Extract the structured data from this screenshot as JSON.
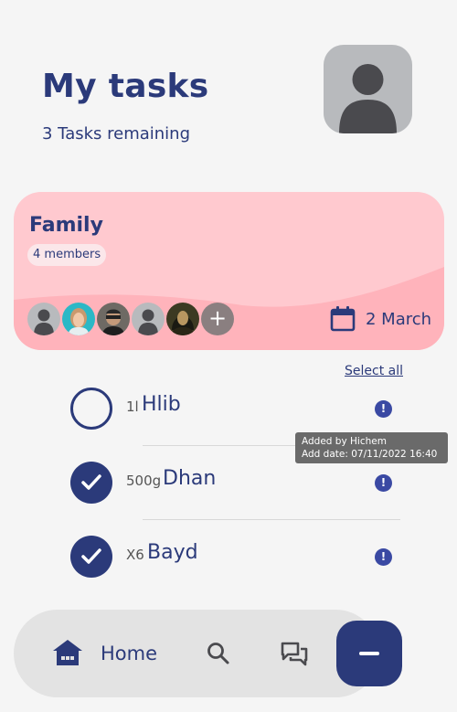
{
  "header": {
    "title": "My tasks",
    "subtitle": "3 Tasks remaining"
  },
  "profile": {
    "icon": "person-icon"
  },
  "family": {
    "title": "Family",
    "members_label": "4 members",
    "date": "2 March",
    "add_icon": "+",
    "card_color": "#ffc9cf"
  },
  "list": {
    "select_all": "Select all",
    "tasks": [
      {
        "qty": "1l",
        "name": "Hlib",
        "done": false
      },
      {
        "qty": "500g",
        "name": "Dhan",
        "done": true
      },
      {
        "qty": "X6",
        "name": "Bayd",
        "done": true
      }
    ],
    "tooltip": {
      "line1": "Added by Hichem",
      "line2": "Add date: 07/11/2022 16:40"
    }
  },
  "nav": {
    "home_label": "Home",
    "icons": [
      "home-icon",
      "search-icon",
      "chat-icon",
      "minus-icon"
    ]
  },
  "colors": {
    "primary": "#2b3a7a",
    "background": "#f5f5f5",
    "info": "#3a49a3"
  }
}
